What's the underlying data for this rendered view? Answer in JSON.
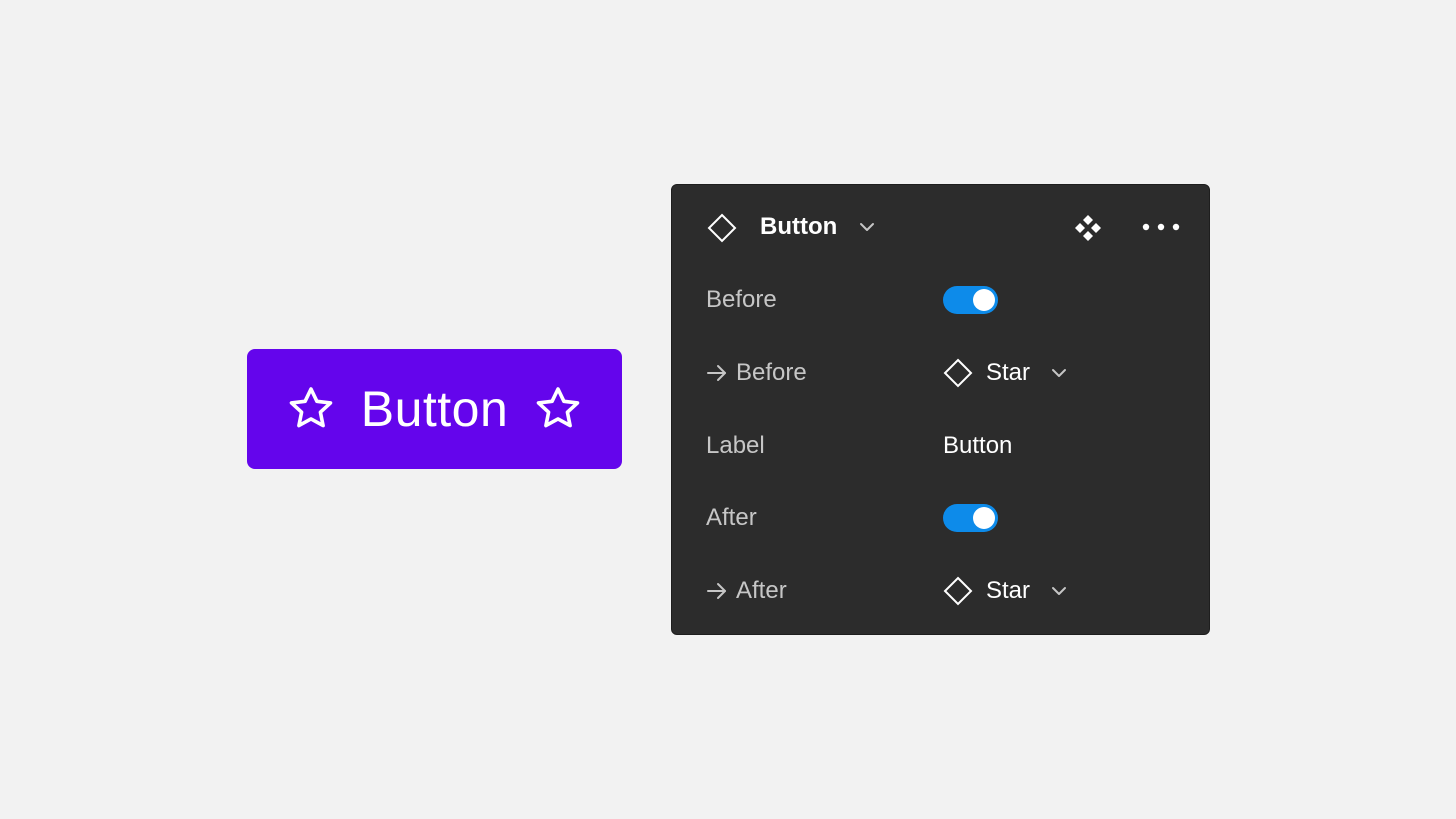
{
  "preview": {
    "label": "Button",
    "leading_icon": "star-icon",
    "trailing_icon": "star-icon",
    "color": "#6405ec"
  },
  "panel": {
    "title": "Button",
    "title_icon": "component-diamond-icon",
    "actions": [
      "component-set-icon",
      "more-options-icon"
    ],
    "background": "#2c2c2c",
    "toggle_color": "#0d8bea",
    "properties": {
      "before": {
        "label": "Before",
        "type": "boolean",
        "value": true
      },
      "before_instance": {
        "label": "Before",
        "type": "instance-swap",
        "value": "Star"
      },
      "label": {
        "label": "Label",
        "type": "text",
        "value": "Button"
      },
      "after": {
        "label": "After",
        "type": "boolean",
        "value": true
      },
      "after_instance": {
        "label": "After",
        "type": "instance-swap",
        "value": "Star"
      }
    }
  }
}
